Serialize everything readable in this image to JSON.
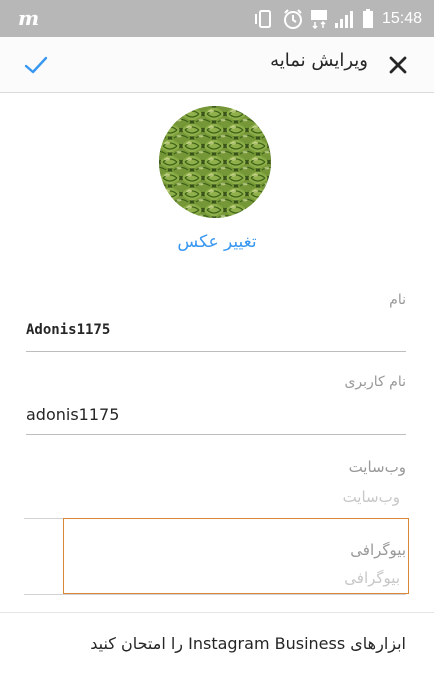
{
  "status_bar": {
    "app_letter": "m",
    "time": "15:48",
    "icons": [
      "vibrate-icon",
      "alarm-icon",
      "data-icon",
      "signal-icon",
      "battery-icon"
    ]
  },
  "header": {
    "title": "ویرایش نمایه",
    "close_icon": "close-icon",
    "confirm_icon": "check-icon"
  },
  "profile": {
    "change_photo_label": "تغییر عکس"
  },
  "fields": {
    "name_label": "نام",
    "name_value": "Adonis1175",
    "username_label": "نام کاربری",
    "username_value": "adonis1175",
    "website_label": "وب‌سایت",
    "website_placeholder": "وب‌سایت",
    "bio_label": "بیوگرافی",
    "bio_placeholder": "بیوگرافی"
  },
  "footer": {
    "business_link": "ابزارهای Instagram Business را امتحان کنید"
  },
  "colors": {
    "accent": "#3897f0",
    "status_bar": "#b7b7b7",
    "highlight_border": "#d9883a"
  }
}
